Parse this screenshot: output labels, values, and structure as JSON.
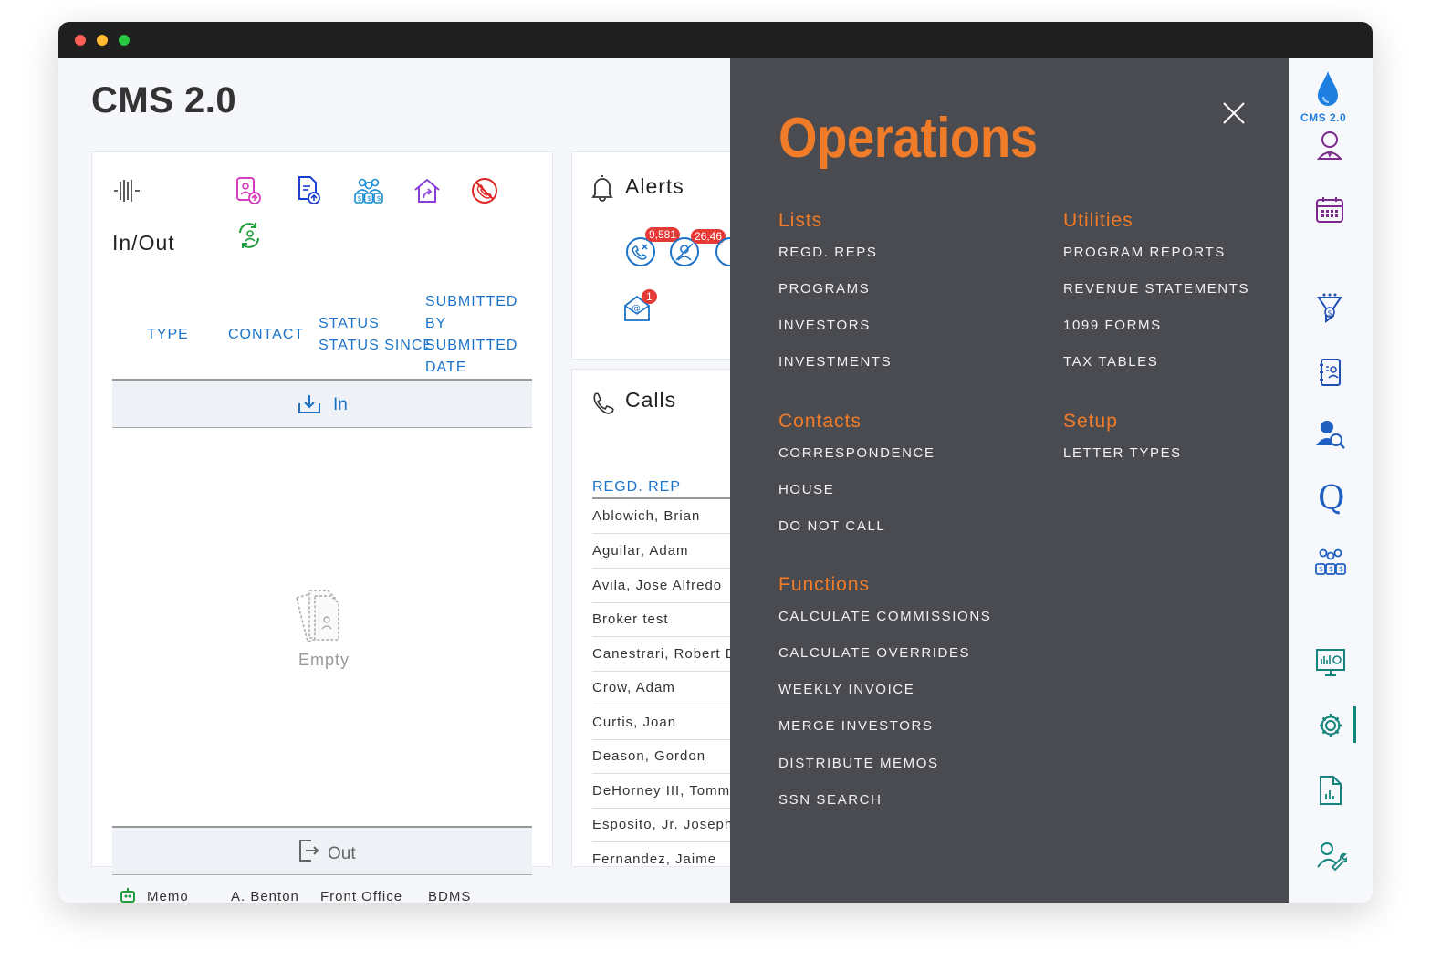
{
  "app": {
    "title": "CMS 2.0",
    "logo_text": "CMS 2.0"
  },
  "inout": {
    "title": "In/Out",
    "columns": {
      "type": "TYPE",
      "contact": "CONTACT",
      "status": "STATUS",
      "status_since": "STATUS SINCE",
      "submitted_by": "SUBMITTED BY",
      "submitted_date": "SUBMITTED DATE"
    },
    "in_label": "In",
    "out_label": "Out",
    "empty_label": "Empty"
  },
  "alerts": {
    "title": "Alerts",
    "badges": [
      "9,581",
      "26,46",
      "1"
    ]
  },
  "calls": {
    "title": "Calls",
    "column": "REGD. REP",
    "rows": [
      "Ablowich, Brian",
      "Aguilar, Adam",
      "Avila, Jose Alfredo",
      "Broker test",
      "Canestrari, Robert D",
      "Crow, Adam",
      "Curtis, Joan",
      "Deason, Gordon",
      "DeHorney III, Tomm",
      "Esposito, Jr. Joseph",
      "Fernandez, Jaime"
    ]
  },
  "status_bar": {
    "memo": "Memo",
    "user": "A. Benton",
    "office": "Front Office",
    "system": "BDMS"
  },
  "operations": {
    "title": "Operations",
    "lists": {
      "heading": "Lists",
      "items": [
        "REGD. REPS",
        "PROGRAMS",
        "INVESTORS",
        "INVESTMENTS"
      ]
    },
    "contacts": {
      "heading": "Contacts",
      "items": [
        "CORRESPONDENCE",
        "HOUSE",
        "DO NOT CALL"
      ]
    },
    "functions": {
      "heading": "Functions",
      "items": [
        "CALCULATE COMMISSIONS",
        "CALCULATE OVERRIDES",
        "WEEKLY INVOICE",
        "MERGE INVESTORS",
        "DISTRIBUTE MEMOS",
        "SSN SEARCH"
      ]
    },
    "utilities": {
      "heading": "Utilities",
      "items": [
        "PROGRAM REPORTS",
        "REVENUE STATEMENTS",
        "1099 FORMS",
        "TAX TABLES"
      ]
    },
    "setup": {
      "heading": "Setup",
      "items": [
        "LETTER TYPES"
      ]
    }
  },
  "rail_icons": [
    "drop-logo-icon",
    "user-icon",
    "calendar-icon",
    "funnel-money-icon",
    "contact-book-icon",
    "user-search-icon",
    "q-icon",
    "group-money-icon",
    "presentation-chart-icon",
    "gear-icon",
    "report-icon",
    "user-wrench-icon"
  ],
  "colors": {
    "accent": "#f07b28",
    "panel": "#4a4b50",
    "link": "#1a73c9",
    "teal": "#13857d",
    "badge": "#e53935"
  }
}
